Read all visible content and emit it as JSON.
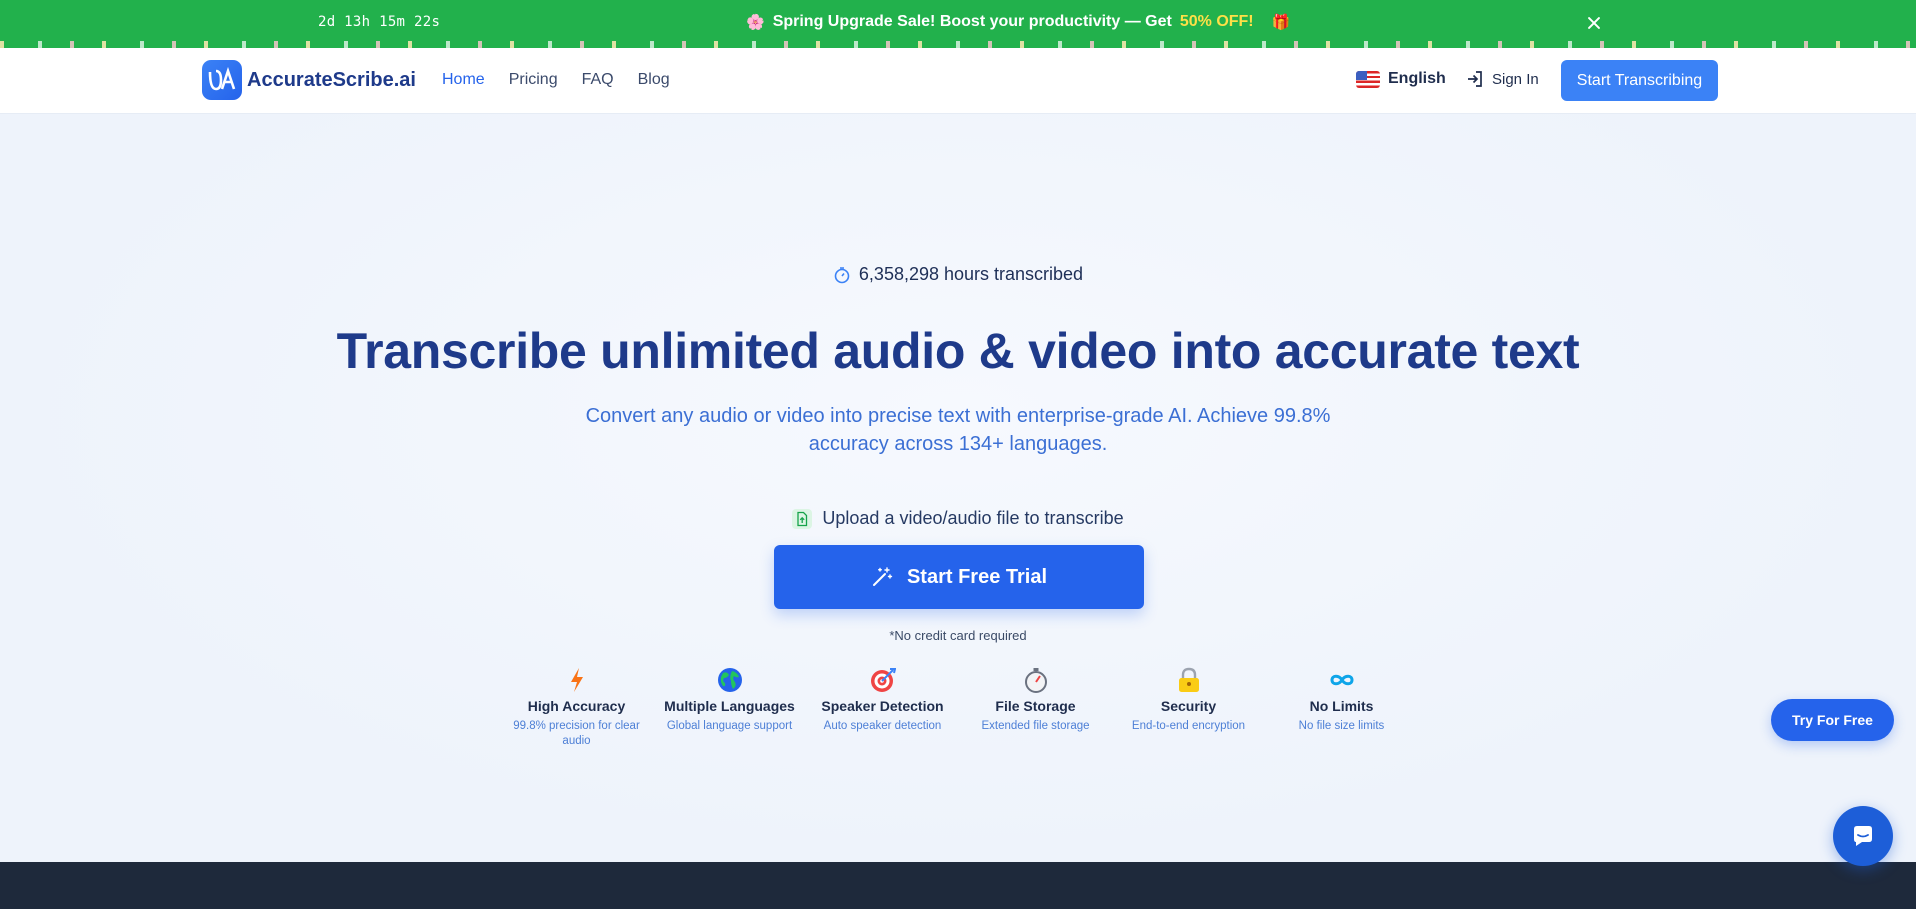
{
  "promo": {
    "countdown": "2d 13h 15m 22s",
    "flower_icon": "🌸",
    "message": "Spring Upgrade Sale! Boost your productivity — Get",
    "discount": "50% OFF!",
    "gift_icon": "🎁",
    "background": "#22b14c"
  },
  "nav": {
    "brand": "AccurateScribe.ai",
    "links": [
      "Home",
      "Pricing",
      "FAQ",
      "Blog"
    ],
    "language": "English",
    "sign_in": "Sign In",
    "cta": "Start Transcribing"
  },
  "hero": {
    "stat": "6,358,298 hours transcribed",
    "headline": "Transcribe unlimited audio & video into accurate text",
    "subhead": "Convert any audio or video into precise text with enterprise-grade AI. Achieve 99.8% accuracy across 134+ languages.",
    "upload_hint": "Upload a video/audio file to transcribe",
    "trial_button": "Start Free Trial",
    "no_card": "*No credit card required"
  },
  "features": [
    {
      "icon": "lightning-icon",
      "title": "High Accuracy",
      "desc": "99.8% precision for clear audio"
    },
    {
      "icon": "globe-icon",
      "title": "Multiple Languages",
      "desc": "Global language support"
    },
    {
      "icon": "target-icon",
      "title": "Speaker Detection",
      "desc": "Auto speaker detection"
    },
    {
      "icon": "stopwatch-icon",
      "title": "File Storage",
      "desc": "Extended file storage"
    },
    {
      "icon": "lock-icon",
      "title": "Security",
      "desc": "End-to-end encryption"
    },
    {
      "icon": "infinity-icon",
      "title": "No Limits",
      "desc": "No file size limits"
    }
  ],
  "floating": {
    "try_free": "Try For Free"
  },
  "colors": {
    "primary": "#2563eb",
    "headline": "#1e3a8a",
    "footer": "#1e293b"
  }
}
